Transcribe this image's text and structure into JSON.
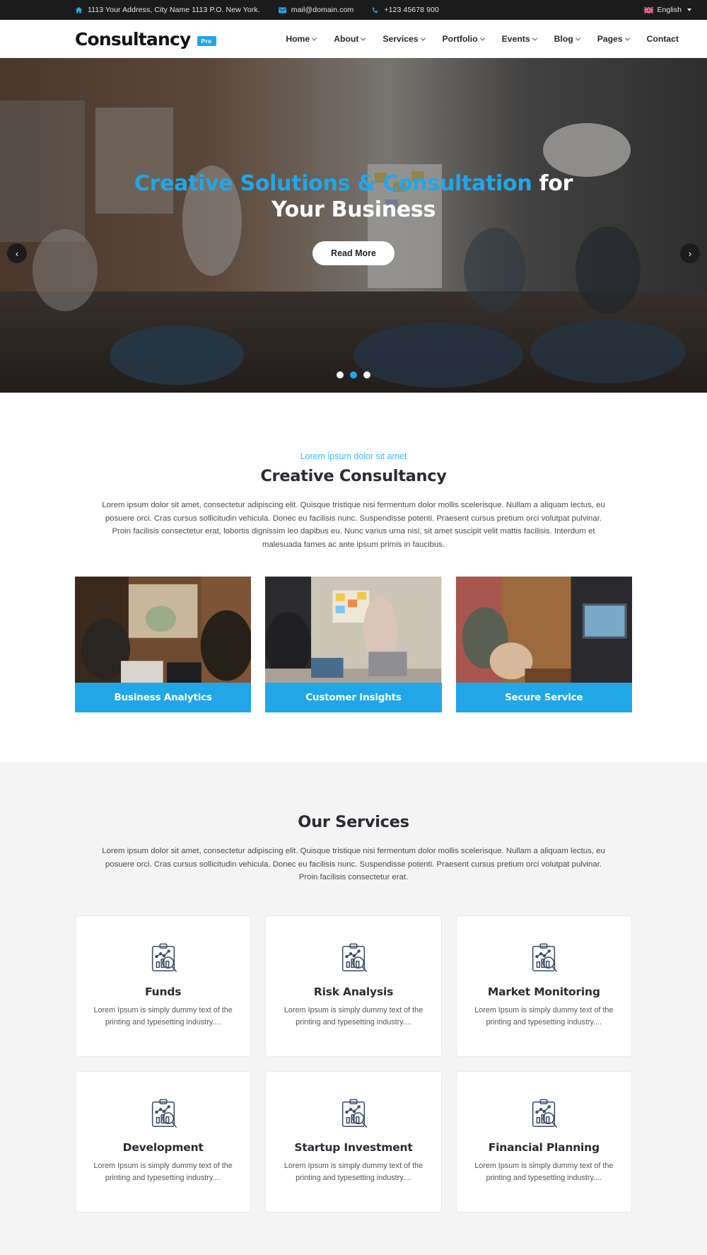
{
  "topbar": {
    "address": "1113 Your Address, City Name 1113 P.O. New York.",
    "email": "mail@domain.com",
    "phone": "+123 45678 900",
    "language": "English",
    "icons": {
      "address": "home-icon",
      "email": "envelope-icon",
      "phone": "phone-icon",
      "flag": "uk-flag-icon"
    },
    "accent": "#21a7e8"
  },
  "header": {
    "logo_text": "Consultancy",
    "logo_badge": "Pro",
    "nav": [
      {
        "label": "Home",
        "has_dropdown": true
      },
      {
        "label": "About",
        "has_dropdown": true
      },
      {
        "label": "Services",
        "has_dropdown": true
      },
      {
        "label": "Portfolio",
        "has_dropdown": true
      },
      {
        "label": "Events",
        "has_dropdown": true
      },
      {
        "label": "Blog",
        "has_dropdown": true
      },
      {
        "label": "Pages",
        "has_dropdown": true
      },
      {
        "label": "Contact",
        "has_dropdown": false
      }
    ]
  },
  "hero": {
    "title_accent": "Creative Solutions & Consultation",
    "title_rest": " for",
    "title_line2": "Your Business",
    "button": "Read More",
    "prev_icon": "chevron-left-icon",
    "next_icon": "chevron-right-icon",
    "slides": 3,
    "active_slide": 1
  },
  "intro": {
    "subtitle": "Lorem ipsum dolor sit amet",
    "title": "Creative Consultancy",
    "description": "Lorem ipsum dolor sit amet, consectetur adipiscing elit. Quisque tristique nisi fermentum dolor mollis scelerisque. Nullam a aliquam lectus, eu posuere orci. Cras cursus sollicitudin vehicula. Donec eu facilisis nunc. Suspendisse potenti. Praesent cursus pretium orci volutpat pulvinar. Proin facilisis consectetur erat, lobortis dignissim leo dapibus eu. Nunc varius urna nisi, sit amet suscipit velit mattis facilisis. Interdum et malesuada fames ac ante ipsum primis in faucibus.",
    "cards": [
      {
        "label": "Business Analytics"
      },
      {
        "label": "Customer Insights"
      },
      {
        "label": "Secure Service"
      }
    ]
  },
  "services": {
    "title": "Our Services",
    "description": "Lorem ipsum dolor sit amet, consectetur adipiscing elit. Quisque tristique nisi fermentum dolor mollis scelerisque. Nullam a aliquam lectus, eu posuere orci. Cras cursus sollicitudin vehicula. Donec eu facilisis nunc. Suspendisse potenti. Praesent cursus pretium orci volutpat pulvinar. Proin facilisis consectetur erat.",
    "icon_name": "clipboard-chart-search-icon",
    "items": [
      {
        "name": "Funds",
        "desc": "Lorem Ipsum is simply dummy text of the printing and typesetting industry...."
      },
      {
        "name": "Risk Analysis",
        "desc": "Lorem Ipsum is simply dummy text of the printing and typesetting industry...."
      },
      {
        "name": "Market Monitoring",
        "desc": "Lorem Ipsum is simply dummy text of the printing and typesetting industry...."
      },
      {
        "name": "Development",
        "desc": "Lorem Ipsum is simply dummy text of the printing and typesetting industry...."
      },
      {
        "name": "Startup Investment",
        "desc": "Lorem Ipsum is simply dummy text of the printing and typesetting industry...."
      },
      {
        "name": "Financial Planning",
        "desc": "Lorem Ipsum is simply dummy text of the printing and typesetting industry...."
      }
    ]
  }
}
